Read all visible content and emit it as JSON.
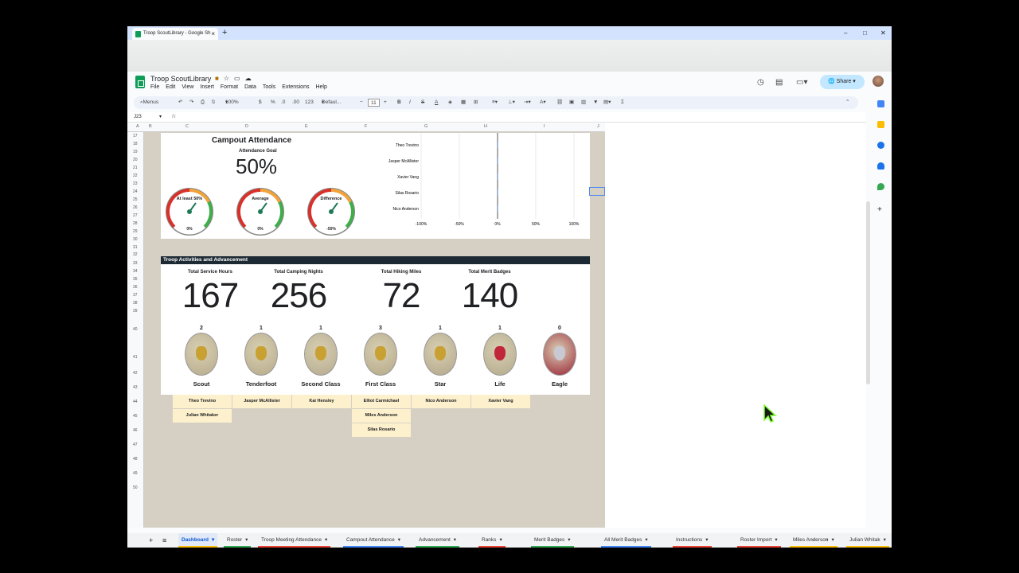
{
  "browser": {
    "tab_title": "Troop ScoutLibrary - Google Sh",
    "new_tab": "+",
    "close": "×",
    "minimize": "–",
    "maximize": "□",
    "window_close": "✕"
  },
  "doc": {
    "title": "Troop ScoutLibrary",
    "menus": [
      "File",
      "Edit",
      "View",
      "Insert",
      "Format",
      "Data",
      "Tools",
      "Extensions",
      "Help"
    ],
    "share_label": "Share"
  },
  "toolbar": {
    "menus": "Menus",
    "zoom": "100%",
    "currency": "$",
    "percent": "%",
    "dec_less": ".0",
    "dec_more": ".00",
    "format": "123",
    "font": "Defaul...",
    "font_size": "11",
    "bold": "B",
    "italic": "I",
    "strike": "S",
    "textcolor": "A"
  },
  "formula_bar": {
    "cell_ref": "J23",
    "fx": "fx"
  },
  "columns": [
    "A",
    "B",
    "C",
    "D",
    "E",
    "F",
    "G",
    "H",
    "I",
    "J"
  ],
  "rows": [
    "17",
    "18",
    "19",
    "20",
    "21",
    "22",
    "23",
    "24",
    "25",
    "26",
    "27",
    "28",
    "29",
    "30",
    "31",
    "32",
    "33",
    "34",
    "35",
    "36",
    "37",
    "38",
    "39",
    "40",
    "41",
    "42",
    "43",
    "44",
    "45",
    "46",
    "47",
    "48",
    "49",
    "50"
  ],
  "attendance": {
    "title": "Campout Attendance",
    "goal_label": "Attendance Goal",
    "goal_value": "50%",
    "gauges": [
      {
        "label": "At least 50%",
        "value": "0%"
      },
      {
        "label": "Average",
        "value": "0%"
      },
      {
        "label": "Difference",
        "value": "-50%"
      }
    ],
    "bar_names": [
      "Theo Trevino",
      "Jasper McAllister",
      "Xavier Vang",
      "Silas Rosario",
      "Nico Anderson"
    ],
    "axis_ticks": [
      "-100%",
      "-50%",
      "0%",
      "50%",
      "100%"
    ]
  },
  "chart_data": {
    "type": "bar",
    "orientation": "horizontal",
    "categories": [
      "Theo Trevino",
      "Jasper McAllister",
      "Xavier Vang",
      "Silas Rosario",
      "Nico Anderson"
    ],
    "values": [
      0,
      0,
      0,
      0,
      0
    ],
    "xlim": [
      -1,
      1
    ],
    "tick_labels": [
      "-100%",
      "-50%",
      "0%",
      "50%",
      "100%"
    ]
  },
  "activities": {
    "band_title": "Troop Activities and Advancement",
    "stats": [
      {
        "label": "Total Service Hours",
        "value": "167"
      },
      {
        "label": "Total Camping Nights",
        "value": "256"
      },
      {
        "label": "Total Hiking Miles",
        "value": "72"
      },
      {
        "label": "Total Merit Badges",
        "value": "140"
      }
    ],
    "ranks": [
      {
        "name": "Scout",
        "count": "2",
        "color": "#b7ab8a",
        "members": [
          "Theo Trevino",
          "Julian Whitaker"
        ]
      },
      {
        "name": "Tenderfoot",
        "count": "1",
        "color": "#b6aa88",
        "members": [
          "Jasper McAllister"
        ]
      },
      {
        "name": "Second Class",
        "count": "1",
        "color": "#b5aa8c",
        "members": [
          "Kai Hensley"
        ]
      },
      {
        "name": "First Class",
        "count": "3",
        "color": "#b4a886",
        "members": [
          "Elliot Carmichael",
          "Miles Anderson",
          "Silas Rosario"
        ]
      },
      {
        "name": "Star",
        "count": "1",
        "color": "#b3a789",
        "members": [
          "Nico Anderson"
        ]
      },
      {
        "name": "Life",
        "count": "1",
        "color": "#b3a98a",
        "members": [
          "Xavier Vang"
        ]
      },
      {
        "name": "Eagle",
        "count": "0",
        "color": "#9b2335",
        "members": []
      }
    ]
  },
  "sheet_tabs": [
    {
      "label": "Dashboard",
      "active": true,
      "color": "#fbbc04"
    },
    {
      "label": "Roster",
      "active": false,
      "color": "#34a853"
    },
    {
      "label": "Troop Meeting Attendance",
      "active": false,
      "color": "#ea4335"
    },
    {
      "label": "Campout Attendance",
      "active": false,
      "color": "#4285f4"
    },
    {
      "label": "Advancement",
      "active": false,
      "color": "#34a853"
    },
    {
      "label": "Ranks",
      "active": false,
      "color": "#ea4335"
    },
    {
      "label": "Merit Badges",
      "active": false,
      "color": "#34a853"
    },
    {
      "label": "All Merit Badges",
      "active": false,
      "color": "#4285f4"
    },
    {
      "label": "Instructions",
      "active": false,
      "color": "#ea4335"
    },
    {
      "label": "Roster Import",
      "active": false,
      "color": "#ea4335"
    },
    {
      "label": "Miles Anderson",
      "active": false,
      "color": "#fbbc04"
    },
    {
      "label": "Julian Whitak",
      "active": false,
      "color": "#fbbc04"
    }
  ]
}
